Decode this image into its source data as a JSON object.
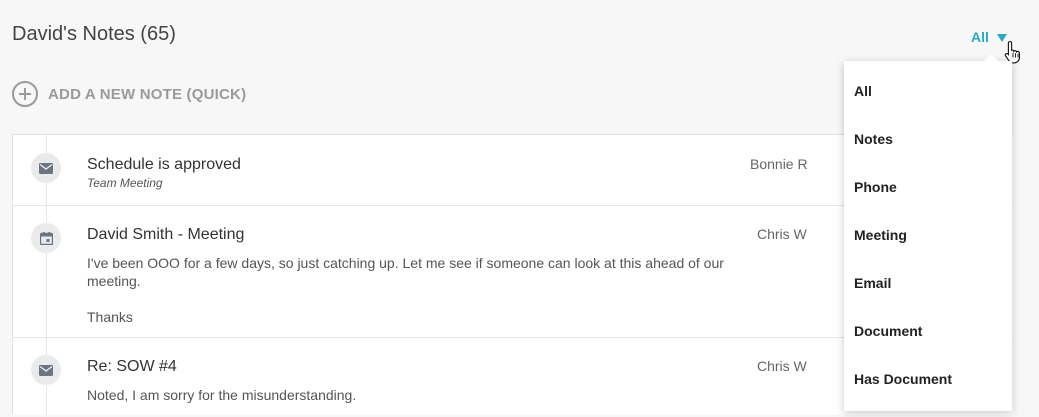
{
  "header": {
    "title": "David's Notes (65)",
    "filter_label": "All"
  },
  "add_note": {
    "label": "ADD A NEW NOTE (QUICK)"
  },
  "notes": [
    {
      "icon": "envelope-icon",
      "title": "Schedule is approved",
      "subtitle": "Team Meeting",
      "body": [],
      "author": "Bonnie R"
    },
    {
      "icon": "calendar-icon",
      "title": "David Smith - Meeting",
      "subtitle": "",
      "body": [
        "I've been OOO for a few days, so just catching up. Let me see if someone can look at this ahead of our",
        "meeting.",
        "Thanks"
      ],
      "author": "Chris W"
    },
    {
      "icon": "envelope-icon",
      "title": "Re: SOW #4",
      "subtitle": "",
      "body": [
        "Noted, I am sorry for the misunderstanding."
      ],
      "author": "Chris W"
    }
  ],
  "filter_dropdown": {
    "options": [
      "All",
      "Notes",
      "Phone",
      "Meeting",
      "Email",
      "Document",
      "Has Document"
    ]
  },
  "colors": {
    "accent": "#2aa8c4",
    "icon": "#6b7480"
  }
}
